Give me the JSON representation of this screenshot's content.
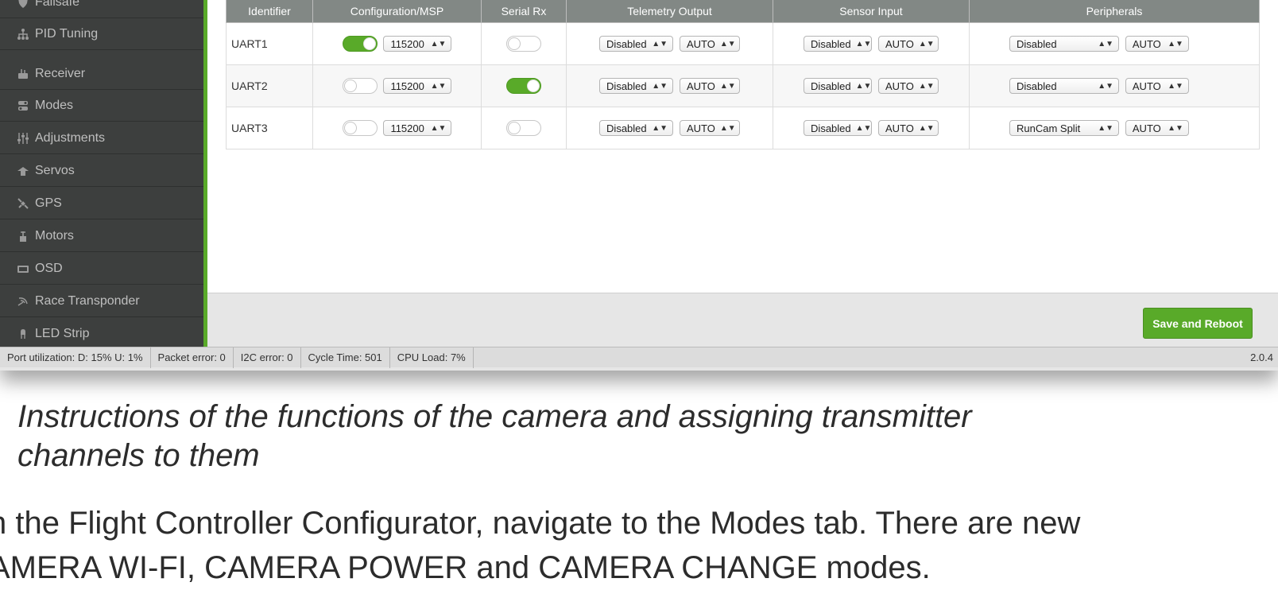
{
  "sidebar": {
    "items": [
      {
        "label": "Failsafe",
        "icon": "shield-icon"
      },
      {
        "label": "PID Tuning",
        "icon": "pid-icon"
      },
      {
        "label": "Receiver",
        "icon": "receiver-icon"
      },
      {
        "label": "Modes",
        "icon": "modes-icon"
      },
      {
        "label": "Adjustments",
        "icon": "sliders-icon"
      },
      {
        "label": "Servos",
        "icon": "servo-icon"
      },
      {
        "label": "GPS",
        "icon": "satellite-icon"
      },
      {
        "label": "Motors",
        "icon": "motor-icon"
      },
      {
        "label": "OSD",
        "icon": "osd-icon"
      },
      {
        "label": "Race Transponder",
        "icon": "transponder-icon"
      },
      {
        "label": "LED Strip",
        "icon": "led-icon"
      }
    ]
  },
  "ports": {
    "columns": [
      "Identifier",
      "Configuration/MSP",
      "Serial Rx",
      "Telemetry Output",
      "Sensor Input",
      "Peripherals"
    ],
    "rows": [
      {
        "id": "UART1",
        "msp_enabled": true,
        "msp_baud": "115200",
        "serial_rx": false,
        "telemetry": "Disabled",
        "telemetry_baud": "AUTO",
        "sensor": "Disabled",
        "sensor_baud": "AUTO",
        "peripheral": "Disabled",
        "peripheral_baud": "AUTO"
      },
      {
        "id": "UART2",
        "msp_enabled": false,
        "msp_baud": "115200",
        "serial_rx": true,
        "telemetry": "Disabled",
        "telemetry_baud": "AUTO",
        "sensor": "Disabled",
        "sensor_baud": "AUTO",
        "peripheral": "Disabled",
        "peripheral_baud": "AUTO"
      },
      {
        "id": "UART3",
        "msp_enabled": false,
        "msp_baud": "115200",
        "serial_rx": false,
        "telemetry": "Disabled",
        "telemetry_baud": "AUTO",
        "sensor": "Disabled",
        "sensor_baud": "AUTO",
        "peripheral": "RunCam Split",
        "peripheral_baud": "AUTO"
      }
    ]
  },
  "footer": {
    "save_label": "Save and Reboot"
  },
  "status": {
    "port_utilization": "Port utilization: D: 15% U: 1%",
    "packet_error": "Packet error: 0",
    "i2c_error": "I2C error: 0",
    "cycle_time": "Cycle Time: 501",
    "cpu_load": "CPU Load: 7%",
    "version": "2.0.4"
  },
  "document": {
    "heading_number": ".",
    "heading_line1": "Instructions of the functions of the camera and assigning transmitter",
    "heading_line2": "channels to them",
    "body_line1": "n the Flight Controller Configurator, navigate to the Modes tab. There are new",
    "body_line2": "AMERA WI-FI, CAMERA POWER and CAMERA CHANGE modes."
  },
  "colors": {
    "accent": "#59aa29",
    "sidebar_bg": "#3d3f3e",
    "table_header": "#828885"
  }
}
